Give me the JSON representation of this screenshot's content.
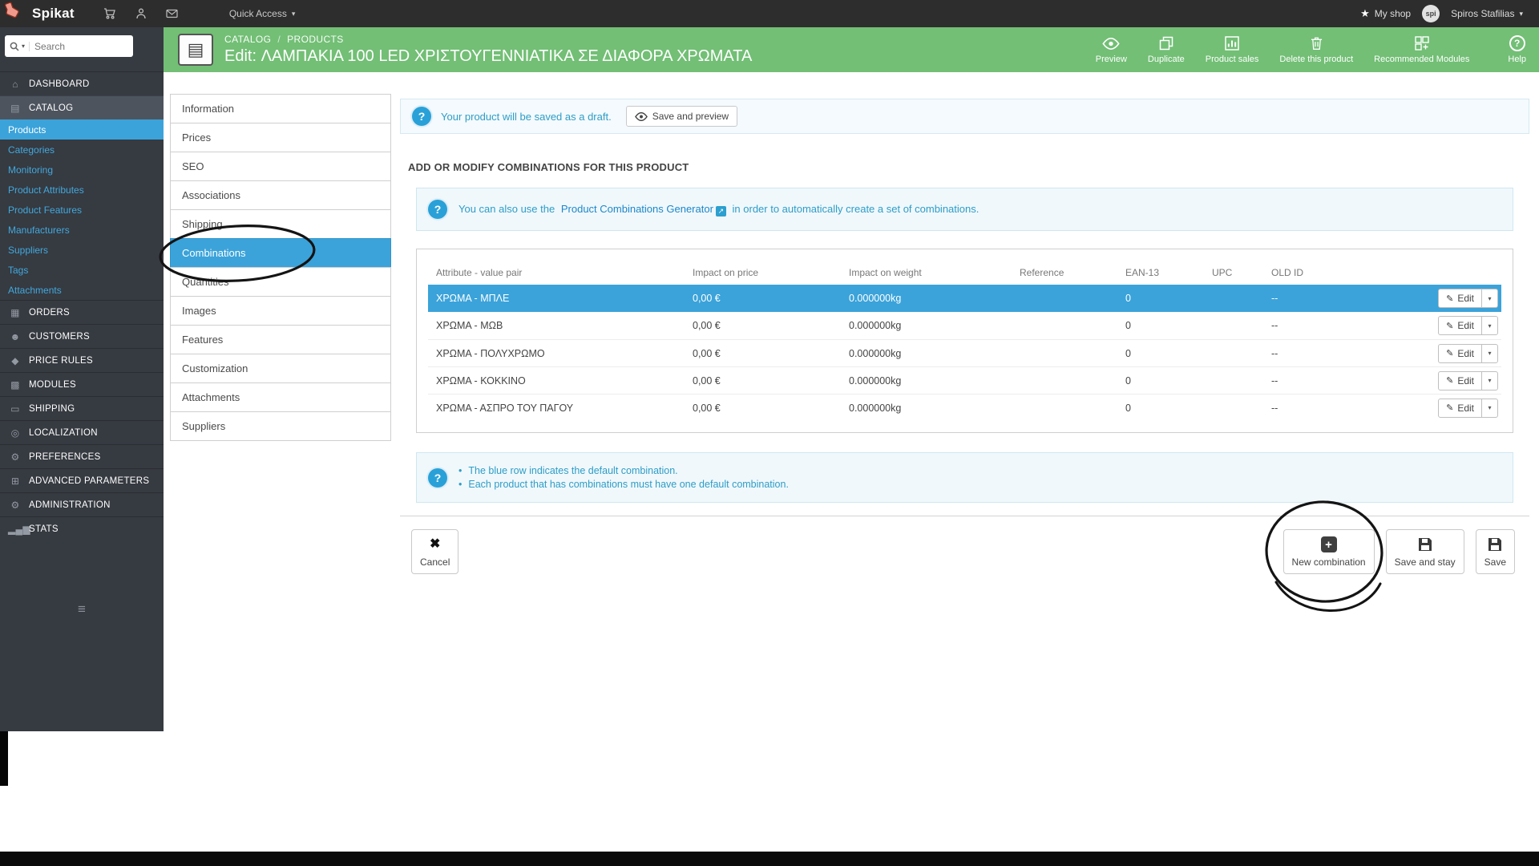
{
  "colors": {
    "accent_green": "#72bf75",
    "highlight_blue": "#3ba3da",
    "sidebar_bg": "#363a41",
    "topbar_bg": "#2d2d2d",
    "info_text": "#2e9dc6"
  },
  "icons": {
    "caret_down": "▾",
    "star": "★",
    "edit_pencil": "✎",
    "cancel_x": "✖",
    "plus": "+",
    "external_arrow": "↗",
    "menu_burger": "≡",
    "book": "▤",
    "question_mark": "?"
  },
  "topbar": {
    "logo": "Spikat",
    "quick_access": "Quick Access",
    "my_shop": "My shop",
    "avatar_initials": "spi",
    "user_name": "Spiros Stafilias"
  },
  "header": {
    "breadcrumb_parent": "CATALOG",
    "breadcrumb_sep": "/",
    "breadcrumb_current": "PRODUCTS",
    "title": "Edit: ΛΑΜΠΑΚΙΑ 100 LED ΧΡΙΣΤΟΥΓΕΝΝΙΑΤΙΚΑ ΣΕ ΔΙΑΦΟΡΑ ΧΡΩΜΑΤΑ",
    "actions": {
      "preview": "Preview",
      "duplicate": "Duplicate",
      "product_sales": "Product sales",
      "delete": "Delete this product",
      "recommended_modules": "Recommended Modules",
      "help": "Help"
    }
  },
  "sidebar": {
    "search_placeholder": "Search",
    "items": [
      {
        "label": "DASHBOARD",
        "icon": "⌂"
      },
      {
        "label": "CATALOG",
        "icon": "▤"
      },
      {
        "label": "ORDERS",
        "icon": "▦"
      },
      {
        "label": "CUSTOMERS",
        "icon": "☻"
      },
      {
        "label": "PRICE RULES",
        "icon": "◆"
      },
      {
        "label": "MODULES",
        "icon": "▩"
      },
      {
        "label": "SHIPPING",
        "icon": "▭"
      },
      {
        "label": "LOCALIZATION",
        "icon": "◎"
      },
      {
        "label": "PREFERENCES",
        "icon": "⚙"
      },
      {
        "label": "ADVANCED PARAMETERS",
        "icon": "⊞"
      },
      {
        "label": "ADMINISTRATION",
        "icon": "⚙"
      },
      {
        "label": "STATS",
        "icon": "▂▄▆"
      }
    ],
    "catalog_submenu": [
      "Products",
      "Categories",
      "Monitoring",
      "Product Attributes",
      "Product Features",
      "Manufacturers",
      "Suppliers",
      "Tags",
      "Attachments"
    ]
  },
  "product_tabs": [
    "Information",
    "Prices",
    "SEO",
    "Associations",
    "Shipping",
    "Combinations",
    "Quantities",
    "Images",
    "Features",
    "Customization",
    "Attachments",
    "Suppliers"
  ],
  "draft_alert": {
    "text": "Your product will be saved as a draft.",
    "button": "Save and preview"
  },
  "section_title": "ADD OR MODIFY COMBINATIONS FOR THIS PRODUCT",
  "generator_note": {
    "before_link": "You can also use the",
    "link": "Product Combinations Generator",
    "after_link": "in order to automatically create a set of combinations."
  },
  "combinations_table": {
    "columns": [
      "Attribute - value pair",
      "Impact on price",
      "Impact on weight",
      "Reference",
      "EAN-13",
      "UPC",
      "OLD ID"
    ],
    "edit_label": "Edit",
    "rows": [
      {
        "attribute": "ΧΡΩΜΑ - ΜΠΛΕ",
        "price": "0,00 €",
        "weight": "0.000000kg",
        "reference": "",
        "ean13": "0",
        "upc": "",
        "old_id": "--"
      },
      {
        "attribute": "ΧΡΩΜΑ - ΜΩΒ",
        "price": "0,00 €",
        "weight": "0.000000kg",
        "reference": "",
        "ean13": "0",
        "upc": "",
        "old_id": "--"
      },
      {
        "attribute": "ΧΡΩΜΑ - ΠΟΛΥΧΡΩΜΟ",
        "price": "0,00 €",
        "weight": "0.000000kg",
        "reference": "",
        "ean13": "0",
        "upc": "",
        "old_id": "--"
      },
      {
        "attribute": "ΧΡΩΜΑ - ΚΟΚΚΙΝΟ",
        "price": "0,00 €",
        "weight": "0.000000kg",
        "reference": "",
        "ean13": "0",
        "upc": "",
        "old_id": "--"
      },
      {
        "attribute": "ΧΡΩΜΑ - ΑΣΠΡΟ ΤΟΥ ΠΑΓΟΥ",
        "price": "0,00 €",
        "weight": "0.000000kg",
        "reference": "",
        "ean13": "0",
        "upc": "",
        "old_id": "--"
      }
    ]
  },
  "default_note": {
    "line1": "The blue row indicates the default combination.",
    "line2": "Each product that has combinations must have one default combination."
  },
  "footer": {
    "cancel": "Cancel",
    "new_combination": "New combination",
    "save_and_stay": "Save and stay",
    "save": "Save"
  }
}
